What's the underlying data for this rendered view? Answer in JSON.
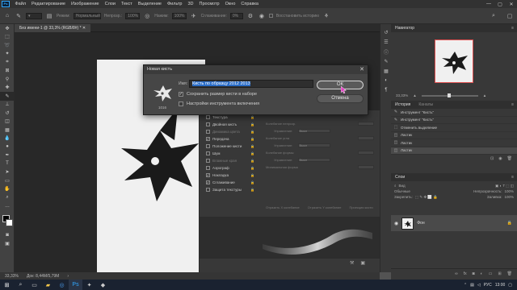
{
  "menubar": {
    "app_icon": "Ps",
    "items": [
      "Файл",
      "Редактирование",
      "Изображение",
      "Слои",
      "Текст",
      "Выделение",
      "Фильтр",
      "3D",
      "Просмотр",
      "Окно",
      "Справка"
    ],
    "window_controls": [
      "—",
      "▢",
      "✕"
    ]
  },
  "optionsbar": {
    "mode_label": "Режим:",
    "mode_value": "Нормальный",
    "opacity_label": "Непрозр.:",
    "opacity_value": "100%",
    "flow_label": "Нажим:",
    "flow_value": "100%",
    "smoothing_label": "Сглаживание:",
    "smoothing_value": "0%",
    "history_label": "Восстановить историю"
  },
  "document": {
    "tab_title": "Без имени-1 @ 33,3% (RGB/8#) *",
    "status_zoom": "33,33%",
    "status_doc": "Док: 8,44М/5,79М",
    "brush_size": "1016"
  },
  "brush_settings": {
    "options": [
      {
        "label": "Текстура",
        "checked": false,
        "dim": false
      },
      {
        "label": "Двойная кисть",
        "checked": false,
        "dim": false
      },
      {
        "label": "Динамика цвета",
        "checked": false,
        "dim": true
      },
      {
        "label": "Передача",
        "checked": true,
        "dim": false
      },
      {
        "label": "Положение кисти",
        "checked": false,
        "dim": false
      },
      {
        "label": "Шум",
        "checked": false,
        "dim": false
      },
      {
        "label": "Влажные края",
        "checked": false,
        "dim": true
      },
      {
        "label": "Аэрограф",
        "checked": false,
        "dim": false
      },
      {
        "label": "Накладка",
        "checked": true,
        "dim": false
      },
      {
        "label": "Сглаживание",
        "checked": true,
        "dim": false
      },
      {
        "label": "Защита текстуры",
        "checked": false,
        "dim": false
      }
    ],
    "right_rows": [
      {
        "label": "Колебание непрозр."
      },
      {
        "label": "Управление:",
        "value": "Выкл"
      },
      {
        "label": "Колебание угла"
      },
      {
        "label": "Управление:",
        "value": "Выкл"
      },
      {
        "label": "Колебание формы"
      },
      {
        "label": "Управление:",
        "value": "Выкл"
      },
      {
        "label": "Минимальная форма"
      }
    ],
    "jitter_checks": [
      "Отразить X колебание",
      "Отразить Y колебание",
      "Проекция кисти"
    ]
  },
  "dialog": {
    "title": "Новая кисть",
    "name_label": "Имя:",
    "name_value": "Кисть по образцу 2012 2013",
    "check_size_label": "Сохранить размер кисти в наборе",
    "check_size": true,
    "check_tool_label": "Настройки инструмента включения",
    "check_tool": false,
    "ok_label": "ОК",
    "cancel_label": "Отмена",
    "thumb_size": "1016"
  },
  "navigator": {
    "tab_label": "Навигатор",
    "zoom_value": "33,33%"
  },
  "history": {
    "tabs": [
      "История",
      "Каналы"
    ],
    "items": [
      "Инструмент \"Кисть\"",
      "Инструмент \"Кисть\"",
      "Отменить выделение",
      "Ластик",
      "Ластик",
      "Ластик"
    ]
  },
  "layers": {
    "tab_label": "Слои",
    "kind_label": "Вид",
    "blend_mode": "Обычные",
    "opacity_label": "Непрозрачность:",
    "opacity_value": "100%",
    "lock_label": "Закрепить:",
    "fill_label": "Заливка:",
    "fill_value": "100%",
    "layer_name": "Фон"
  },
  "taskbar": {
    "lang": "РУС",
    "time": "13:00"
  },
  "colors": {
    "accent": "#2a6cc6",
    "ps_blue": "#31a8ff",
    "panel_bg": "#383838",
    "canvas_bg": "#282828"
  }
}
